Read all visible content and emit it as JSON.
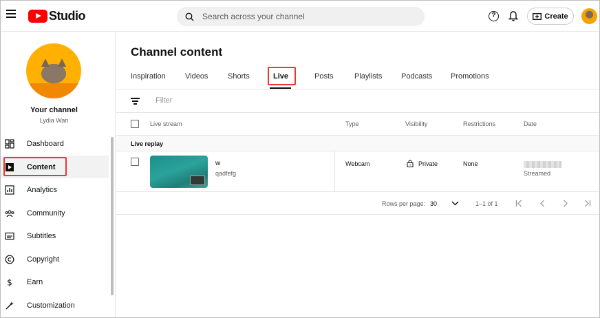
{
  "topbar": {
    "logo_text": "Studio",
    "search_placeholder": "Search across your channel",
    "create_label": "Create"
  },
  "sidebar": {
    "your_channel": "Your channel",
    "channel_name": "Lydia Wan",
    "items": [
      {
        "label": "Dashboard",
        "icon": "dashboard-icon"
      },
      {
        "label": "Content",
        "icon": "content-icon",
        "active": true
      },
      {
        "label": "Analytics",
        "icon": "analytics-icon"
      },
      {
        "label": "Community",
        "icon": "community-icon"
      },
      {
        "label": "Subtitles",
        "icon": "subtitles-icon"
      },
      {
        "label": "Copyright",
        "icon": "copyright-icon"
      },
      {
        "label": "Earn",
        "icon": "earn-icon"
      },
      {
        "label": "Customization",
        "icon": "customization-icon"
      }
    ]
  },
  "main": {
    "title": "Channel content",
    "tabs": [
      "Inspiration",
      "Videos",
      "Shorts",
      "Live",
      "Posts",
      "Playlists",
      "Podcasts",
      "Promotions"
    ],
    "active_tab": "Live",
    "filter_placeholder": "Filter",
    "columns": [
      "Live stream",
      "Type",
      "Visibility",
      "Restrictions",
      "Date"
    ],
    "section_label": "Live replay",
    "rows": [
      {
        "title": "w",
        "description": "qadfefg",
        "type": "Webcam",
        "visibility": "Private",
        "restrictions": "None",
        "date_status": "Streamed"
      }
    ],
    "pagination": {
      "rows_per_page_label": "Rows per page:",
      "rows_per_page": "30",
      "range": "1–1 of 1"
    }
  },
  "colors": {
    "accent_red": "#ff0000",
    "highlight_box": "#e53935"
  }
}
